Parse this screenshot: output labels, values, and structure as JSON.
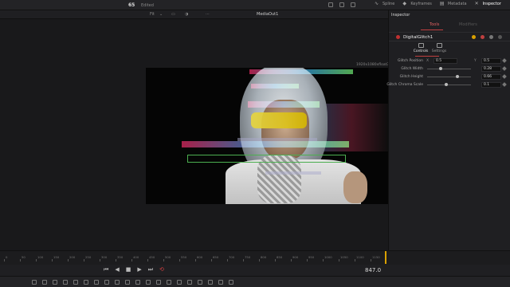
{
  "topbar": {
    "project_number": "65",
    "project_status": "Edited",
    "tabs": [
      {
        "label": "Spline",
        "icon": "spline-icon"
      },
      {
        "label": "Keyframes",
        "icon": "keyframes-icon"
      },
      {
        "label": "Metadata",
        "icon": "metadata-icon"
      },
      {
        "label": "Inspector",
        "icon": "inspector-icon"
      }
    ]
  },
  "viewer": {
    "title": "MediaOut1",
    "zoom": "Fit",
    "resolution_label": "1920x1080xfloat32"
  },
  "inspector": {
    "title": "Inspector",
    "tabs": {
      "tools": "Tools",
      "modifiers": "Modifiers"
    },
    "node_name": "DigitalGlitch1",
    "control_tabs": {
      "controls": "Controls",
      "settings": "Settings"
    },
    "params": {
      "glitch_position": {
        "label": "Glitch Position",
        "x_axis": "X",
        "x": "0.5",
        "y_axis": "Y",
        "y": "0.5"
      },
      "glitch_width": {
        "label": "Glitch Width",
        "value": "0.28"
      },
      "glitch_height": {
        "label": "Glitch Height",
        "value": "0.66"
      },
      "glitch_chroma_scale": {
        "label": "Glitch Chroma Scale",
        "value": "0.1"
      }
    }
  },
  "timeline": {
    "ticks": [
      "0",
      "50",
      "100",
      "150",
      "200",
      "250",
      "300",
      "350",
      "400",
      "450",
      "500",
      "550",
      "600",
      "650",
      "700",
      "750",
      "800",
      "850",
      "900",
      "950",
      "1000",
      "1050",
      "1100",
      "1150"
    ],
    "current_frame": "847.0"
  },
  "colors": {
    "accent_red": "#c04040",
    "playhead": "#d9a000",
    "glitch_box": "#4caf50"
  }
}
